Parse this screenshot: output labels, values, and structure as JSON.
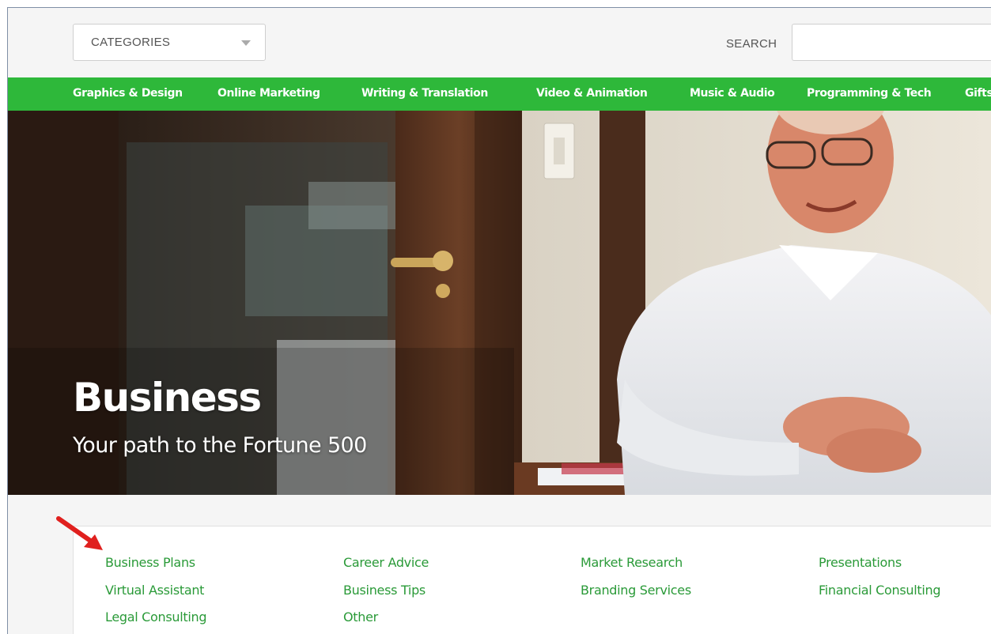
{
  "header": {
    "categories_label": "CATEGORIES",
    "search_label": "SEARCH",
    "search_value": ""
  },
  "nav": {
    "items": [
      "Graphics & Design",
      "Online Marketing",
      "Writing & Translation",
      "Video & Animation",
      "Music & Audio",
      "Programming & Tech",
      "Gifts"
    ]
  },
  "hero": {
    "title": "Business",
    "subtitle": "Your path to the Fortune 500"
  },
  "subcategories": [
    "Business Plans",
    "Career Advice",
    "Market Research",
    "Presentations",
    "Virtual Assistant",
    "Business Tips",
    "Branding Services",
    "Financial Consulting",
    "Legal Consulting",
    "Other"
  ],
  "colors": {
    "nav_green": "#2eb83a",
    "link_green": "#2a9a38",
    "annotation_arrow": "#e0201e"
  },
  "icons": {
    "dropdown": "caret-down-icon",
    "annotation": "red-arrow-icon"
  }
}
